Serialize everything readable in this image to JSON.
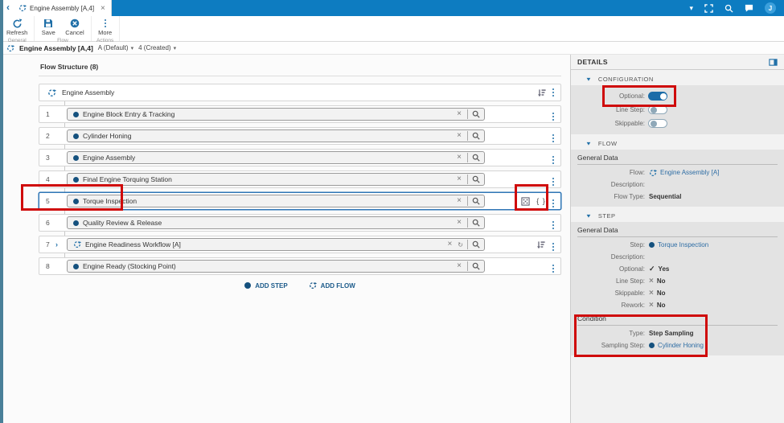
{
  "icons": {
    "back": "‹",
    "close": "×",
    "caret": "▾",
    "chevron": "›",
    "braces": "{ }",
    "check": "✓",
    "cross": "×",
    "avatar_initial": "J"
  },
  "topbar": {
    "tab_title": "Engine Assembly [A,4]"
  },
  "ribbon": {
    "groups": [
      {
        "caption": "General",
        "buttons": [
          {
            "label": "Refresh",
            "icon": "refresh"
          }
        ]
      },
      {
        "caption": "Flow",
        "buttons": [
          {
            "label": "Save",
            "icon": "save"
          },
          {
            "label": "Cancel",
            "icon": "cancel"
          }
        ]
      },
      {
        "caption": "Actions",
        "buttons": [
          {
            "label": "More",
            "icon": "more"
          }
        ]
      }
    ]
  },
  "breadcrumb": {
    "title": "Engine Assembly [A,4]",
    "chips": [
      {
        "label": "A (Default)"
      },
      {
        "label": "4 (Created)"
      }
    ]
  },
  "flow_structure": {
    "title": "Flow Structure (8)",
    "root_label": "Engine Assembly",
    "rows": [
      {
        "num": "1",
        "label": "Engine Block Entry & Tracking",
        "kind": "step"
      },
      {
        "num": "2",
        "label": "Cylinder Honing",
        "kind": "step"
      },
      {
        "num": "3",
        "label": "Engine Assembly",
        "kind": "step"
      },
      {
        "num": "4",
        "label": "Final Engine Torquing Station",
        "kind": "step"
      },
      {
        "num": "5",
        "label": "Torque Inspection",
        "kind": "step",
        "selected": true,
        "condition_icons": true
      },
      {
        "num": "6",
        "label": "Quality Review & Release",
        "kind": "step"
      },
      {
        "num": "7",
        "label": "Engine Readiness Workflow [A]",
        "kind": "flow",
        "expandable": true,
        "sortable": true
      },
      {
        "num": "8",
        "label": "Engine Ready (Stocking Point)",
        "kind": "step"
      }
    ],
    "add_step": "ADD STEP",
    "add_flow": "ADD FLOW"
  },
  "details": {
    "title": "DETAILS",
    "sections": {
      "configuration": {
        "label": "CONFIGURATION",
        "toggles": [
          {
            "label": "Optional:",
            "on": true
          },
          {
            "label": "Line Step:",
            "on": false
          },
          {
            "label": "Skippable:",
            "on": false
          }
        ]
      },
      "flow": {
        "label": "FLOW",
        "subheader": "General Data",
        "fields": [
          {
            "label": "Flow:",
            "value": "Engine Assembly [A]",
            "link": true,
            "icon": "flow"
          },
          {
            "label": "Description:",
            "value": ""
          },
          {
            "label": "Flow Type:",
            "value": "Sequential",
            "bold": true
          }
        ]
      },
      "step": {
        "label": "STEP",
        "subheader": "General Data",
        "fields": [
          {
            "label": "Step:",
            "value": "Torque Inspection",
            "link": true,
            "icon": "dot"
          },
          {
            "label": "Description:",
            "value": ""
          },
          {
            "label": "Optional:",
            "value": "Yes",
            "mark": "check",
            "bold": true
          },
          {
            "label": "Line Step:",
            "value": "No",
            "mark": "cross",
            "bold": true
          },
          {
            "label": "Skippable:",
            "value": "No",
            "mark": "cross",
            "bold": true
          },
          {
            "label": "Rework:",
            "value": "No",
            "mark": "cross",
            "bold": true
          }
        ],
        "condition": {
          "label": "Condition",
          "fields": [
            {
              "label": "Type:",
              "value": "Step Sampling",
              "bold": true
            },
            {
              "label": "Sampling Step:",
              "value": "Cylinder Honing",
              "link": true,
              "icon": "dot"
            }
          ]
        }
      }
    }
  }
}
